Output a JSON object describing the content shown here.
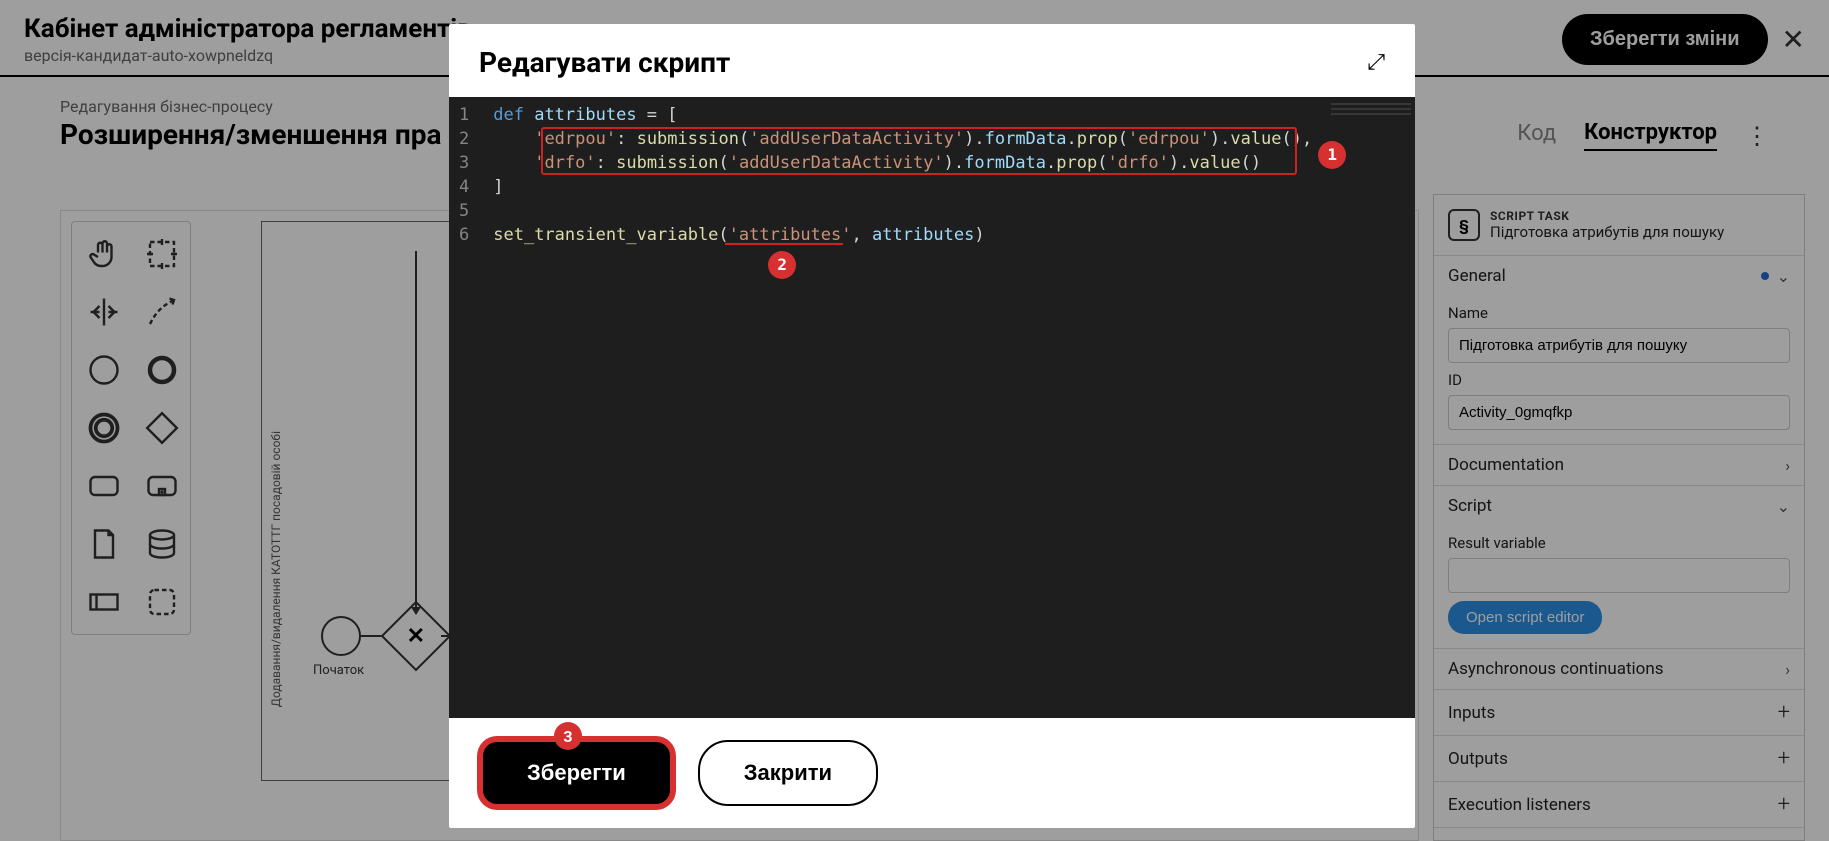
{
  "header": {
    "title": "Кабінет адміністратора регламентів",
    "subtitle": "версія-кандидат-auto-xowpneldzq",
    "save_button": "Зберегти зміни"
  },
  "subheader": {
    "eyebrow": "Редагування бізнес-процесу",
    "title": "Розширення/зменшення пра",
    "tab_code": "Код",
    "tab_constructor": "Конструктор"
  },
  "bpmn": {
    "start_label": "Початок",
    "lane_label": "Додавання/видалення КАТОТТГ посадовій особі"
  },
  "props": {
    "type_label": "SCRIPT TASK",
    "task_title": "Підготовка атрибутів для пошуку",
    "sections": {
      "general": "General",
      "documentation": "Documentation",
      "script": "Script",
      "async": "Asynchronous continuations",
      "inputs": "Inputs",
      "outputs": "Outputs",
      "exec_listeners": "Execution listeners"
    },
    "name_label": "Name",
    "name_value": "Підготовка атрибутів для пошуку",
    "id_label": "ID",
    "id_value": "Activity_0gmqfkp",
    "result_var_label": "Result variable",
    "result_var_value": "",
    "open_editor": "Open script editor"
  },
  "modal": {
    "title": "Редагувати скрипт",
    "save": "Зберегти",
    "close": "Закрити"
  },
  "callouts": {
    "c1": "1",
    "c2": "2",
    "c3": "3"
  },
  "code": {
    "line_numbers": [
      "1",
      "2",
      "3",
      "4",
      "5",
      "6"
    ],
    "l1": {
      "a": "def ",
      "b": "attributes",
      "c": " = ["
    },
    "l2": {
      "indent": "    ",
      "a": "'edrpou'",
      "b": ": ",
      "c": "submission",
      "d": "(",
      "e": "'addUserDataActivity'",
      "f": ").",
      "g": "formData",
      "h": ".",
      "i": "prop",
      "j": "(",
      "k": "'edrpou'",
      "l": ").",
      "m": "value",
      "n": "(),"
    },
    "l3": {
      "indent": "    ",
      "a": "'drfo'",
      "b": ": ",
      "c": "submission",
      "d": "(",
      "e": "'addUserDataActivity'",
      "f": ").",
      "g": "formData",
      "h": ".",
      "i": "prop",
      "j": "(",
      "k": "'drfo'",
      "l": ").",
      "m": "value",
      "n": "()"
    },
    "l4": "]",
    "l6": {
      "a": "set_transient_variable",
      "b": "(",
      "c": "'attributes'",
      "d": ", ",
      "e": "attributes",
      "f": ")"
    }
  }
}
